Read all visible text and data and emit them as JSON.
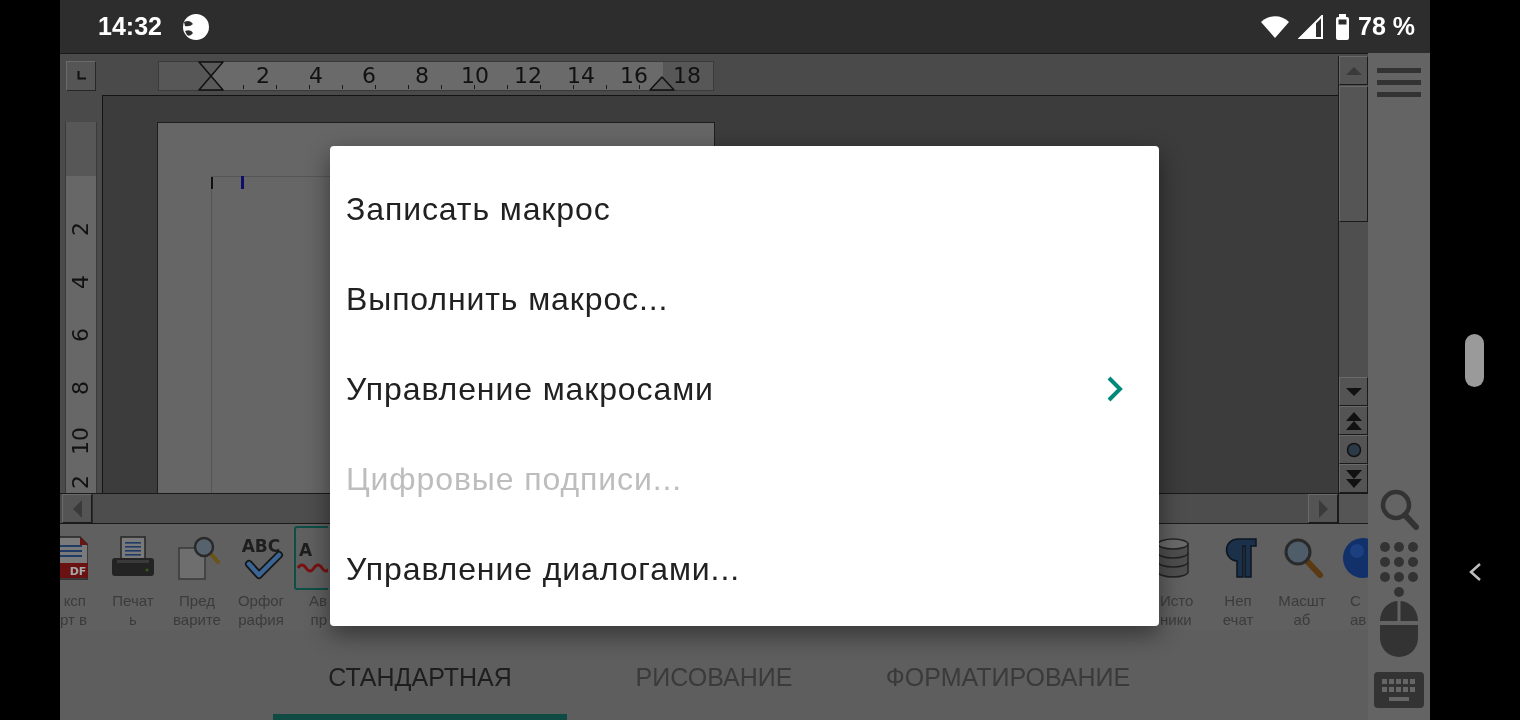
{
  "status_bar": {
    "time": "14:32",
    "battery": "78 %"
  },
  "ruler": {
    "horizontal": [
      "2",
      "4",
      "6",
      "8",
      "10",
      "12",
      "14",
      "16",
      "18"
    ],
    "vertical": [
      "2",
      "4",
      "6",
      "8",
      "10",
      "2"
    ]
  },
  "menu": {
    "items": [
      {
        "label": "Записать макрос",
        "disabled": false,
        "submenu": false
      },
      {
        "label": "Выполнить макрос...",
        "disabled": false,
        "submenu": false
      },
      {
        "label": "Управление макросами",
        "disabled": false,
        "submenu": true
      },
      {
        "label": "Цифровые подписи...",
        "disabled": true,
        "submenu": false
      },
      {
        "label": "Управление диалогами...",
        "disabled": false,
        "submenu": false
      }
    ]
  },
  "toolbar": {
    "left_items": [
      {
        "kind": "pdf",
        "icon_text": "DF",
        "label": [
          "ксп",
          "рт в"
        ],
        "on": false
      },
      {
        "kind": "printer",
        "label": [
          "Печат",
          "ь"
        ],
        "on": false
      },
      {
        "kind": "preview",
        "label": [
          "Пред",
          "варите"
        ],
        "on": false
      },
      {
        "kind": "spellcheck",
        "icon_text": "ABC",
        "label": [
          "Орфог",
          "рафия"
        ],
        "on": false
      },
      {
        "kind": "autospell",
        "icon_text": "A",
        "label": [
          "Ав",
          "пр"
        ],
        "on": true
      }
    ],
    "right_items": [
      {
        "kind": "database",
        "label": [
          "Исто",
          "ники"
        ],
        "on": false
      },
      {
        "kind": "formatting_marks",
        "label": [
          "Неп",
          "ечат"
        ],
        "on": false
      },
      {
        "kind": "zoom",
        "label": [
          "Масшт",
          "аб"
        ],
        "on": false
      },
      {
        "kind": "help",
        "label": [
          "С",
          "ав"
        ],
        "on": false
      }
    ]
  },
  "tabs": [
    {
      "label": "СТАНДАРТНАЯ",
      "selected": true
    },
    {
      "label": "РИСОВАНИЕ",
      "selected": false
    },
    {
      "label": "ФОРМАТИРОВАНИЕ",
      "selected": false
    }
  ]
}
